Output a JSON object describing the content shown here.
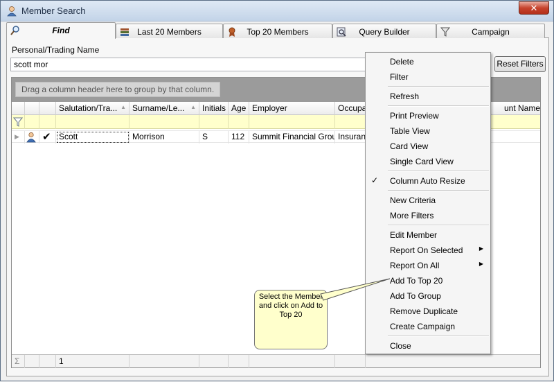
{
  "window": {
    "title": "Member Search",
    "close_label": "✕"
  },
  "tabs": [
    {
      "label": "Find",
      "icon": "find-icon",
      "active": true
    },
    {
      "label": "Last 20 Members",
      "icon": "books-icon"
    },
    {
      "label": "Top 20 Members",
      "icon": "award-icon"
    },
    {
      "label": "Query Builder",
      "icon": "query-icon"
    },
    {
      "label": "Campaign",
      "icon": "funnel-icon"
    }
  ],
  "search": {
    "label": "Personal/Trading Name",
    "value": "scott mor",
    "reset_label": "Reset Filters"
  },
  "grid": {
    "group_hint": "Drag a column header here to group by that column.",
    "columns": [
      "Salutation/Tra...",
      "Surname/Le...",
      "Initials",
      "Age",
      "Employer",
      "Occupa",
      "unt Name"
    ],
    "row": {
      "salutation": "Scott",
      "surname": "Morrison",
      "initials": "S",
      "age": "112",
      "employer": "Summit Financial Grou...",
      "occupation": "Insuranc"
    },
    "footer_count": "1",
    "sum_symbol": "Σ"
  },
  "context_menu": {
    "items": [
      "Delete",
      "Filter",
      "Refresh",
      "Print Preview",
      "Table View",
      "Card View",
      "Single Card View",
      "Column Auto Resize",
      "New Criteria",
      "More Filters",
      "Edit Member",
      "Report On Selected",
      "Report On All",
      "Add To Top 20",
      "Add To Group",
      "Remove Duplicate",
      "Create Campaign",
      "Close"
    ],
    "checked_item": "Column Auto Resize",
    "check_mark": "✓",
    "submenu_arrow": "▶"
  },
  "callout": {
    "text": "Select the Member and click on Add to Top 20"
  },
  "colors": {
    "filter_row": "#ffffcc",
    "group_panel": "#9b9b9b",
    "callout_bg": "#ffffcc"
  }
}
